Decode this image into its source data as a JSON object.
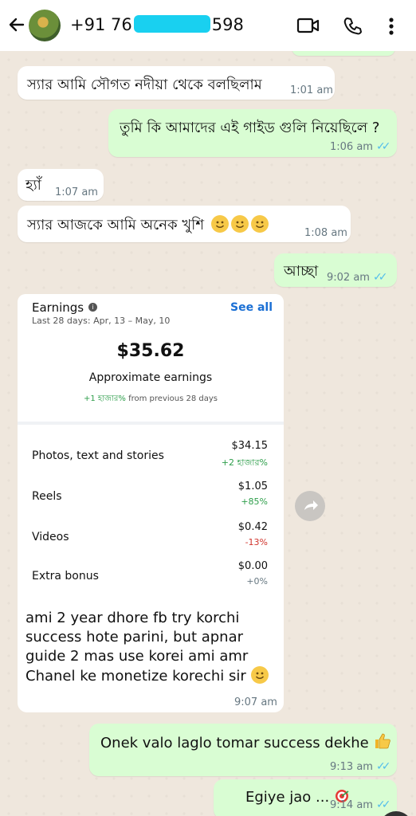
{
  "header": {
    "contact_prefix": "+91 76",
    "contact_suffix": "598"
  },
  "messages": [
    {
      "text": "স্যার আমি সৌগত নদীয়া থেকে বলছিলাম",
      "time": "1:01 am"
    },
    {
      "text": "তুমি কি আমাদের এই গাইড গুলি নিয়েছিলে ?",
      "time": "1:06 am"
    },
    {
      "text": "হ্যাঁ",
      "time": "1:07 am"
    },
    {
      "text": "স্যার আজকে আমি অনেক খুশি",
      "time": "1:08 am"
    },
    {
      "text": "আচ্ছা",
      "time": "9:02 am"
    },
    {
      "text": "Onek valo laglo tomar success dekhe",
      "time": "9:13 am"
    },
    {
      "text": "Egiye jao ...",
      "time": "9:14 am"
    }
  ],
  "card": {
    "title": "Earnings",
    "info_icon": "i",
    "see_all": "See all",
    "period": "Last 28 days: Apr, 13 – May, 10",
    "amount": "$35.62",
    "amount_label": "Approximate earnings",
    "change": "+1 হাজার%",
    "change_suffix": "from previous 28 days",
    "rows": [
      {
        "label": "Photos, text and stories",
        "value": "$34.15",
        "change": "+2 হাজার%",
        "color": "#2e9e4b"
      },
      {
        "label": "Reels",
        "value": "$1.05",
        "change": "+85%",
        "color": "#2e9e4b"
      },
      {
        "label": "Videos",
        "value": "$0.42",
        "change": "-13%",
        "color": "#d0342c"
      },
      {
        "label": "Extra bonus",
        "value": "$0.00",
        "change": "+0%",
        "color": "#667781"
      }
    ],
    "caption_lines": [
      "ami 2 year dhore fb try korchi",
      "success hote parini, but apnar",
      "guide 2 mas use korei ami amr",
      "Chanel ke monetize korechi sir"
    ],
    "time": "9:07 am"
  },
  "colors": {
    "accent_tick": "#53bdeb",
    "outgoing": "#d9fdd3",
    "incoming": "#ffffff",
    "redaction": "#19d0f0"
  },
  "icons": [
    "back-arrow-icon",
    "video-call-icon",
    "phone-icon",
    "more-vert-icon",
    "forward-icon",
    "smile-emoji-icon",
    "thumbs-up-emoji-icon",
    "target-emoji-icon",
    "info-icon"
  ]
}
